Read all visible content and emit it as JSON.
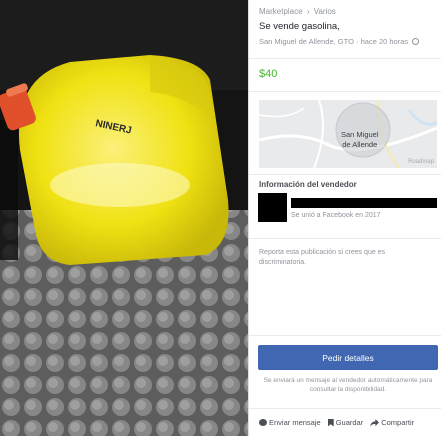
{
  "photo": {
    "jug_lettering": "NINERJ",
    "colors": {
      "jug": "#f0e212",
      "cap": "#e0502a",
      "floor": "#8e8e8e"
    }
  },
  "breadcrumb": {
    "root": "Marketplace",
    "separator": "›",
    "category": "Varios"
  },
  "listing": {
    "title": "Se vende gasolina,",
    "location": "San Miguel de Allende, GTO",
    "meta_separator": "·",
    "posted": "hace 20 horas",
    "price": "$40",
    "price_color": "#42b72a"
  },
  "map": {
    "label_line1": "San Miguel",
    "label_line2": "de Allende",
    "credit": "Roadmap"
  },
  "seller": {
    "section_title": "Información del vendedor",
    "joined": "Se unió a Facebook en 2017"
  },
  "report": {
    "text": "Reporta esta publicación si crees que es discriminatoria."
  },
  "cta": {
    "label": "Pedir detalles",
    "note": "Se enviará un mensaje al vendedor automáticamente para consultar la disponibilidad.",
    "color": "#4267b2"
  },
  "actions": {
    "message": "Enviar mensaje",
    "save": "Guardar",
    "share": "Compartir"
  }
}
